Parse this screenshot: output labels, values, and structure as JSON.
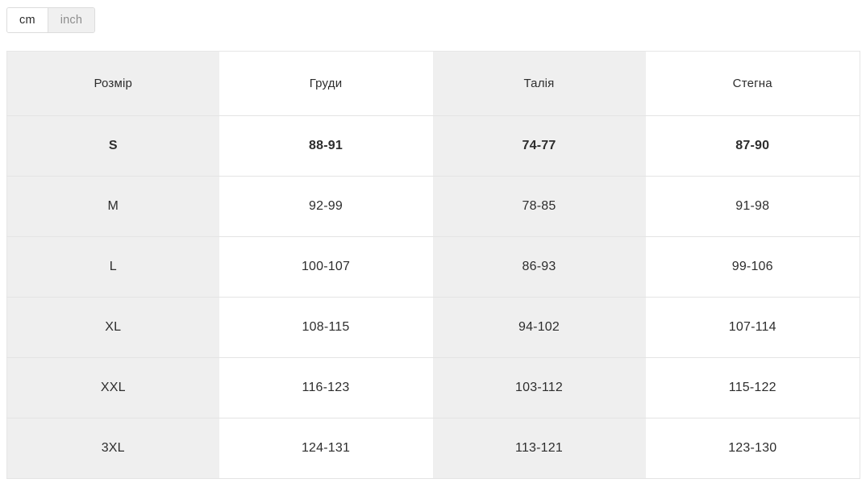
{
  "units": {
    "options": [
      {
        "label": "cm",
        "active": true
      },
      {
        "label": "inch",
        "active": false
      }
    ],
    "selected": "cm"
  },
  "table": {
    "columns": [
      "Розмір",
      "Груди",
      "Талія",
      "Стегна"
    ],
    "rows": [
      {
        "size": "S",
        "chest": "88-91",
        "waist": "74-77",
        "hips": "87-90",
        "highlight": true
      },
      {
        "size": "M",
        "chest": "92-99",
        "waist": "78-85",
        "hips": "91-98",
        "highlight": false
      },
      {
        "size": "L",
        "chest": "100-107",
        "waist": "86-93",
        "hips": "99-106",
        "highlight": false
      },
      {
        "size": "XL",
        "chest": "108-115",
        "waist": "94-102",
        "hips": "107-114",
        "highlight": false
      },
      {
        "size": "XXL",
        "chest": "116-123",
        "waist": "103-112",
        "hips": "115-122",
        "highlight": false
      },
      {
        "size": "3XL",
        "chest": "124-131",
        "waist": "113-121",
        "hips": "123-130",
        "highlight": false
      }
    ]
  },
  "colors": {
    "shaded_cell": "#efefef",
    "plain_cell": "#ffffff",
    "border": "#e4e4e4",
    "text": "#2d2d2d",
    "inactive_tab_text": "#8d8d8d"
  }
}
